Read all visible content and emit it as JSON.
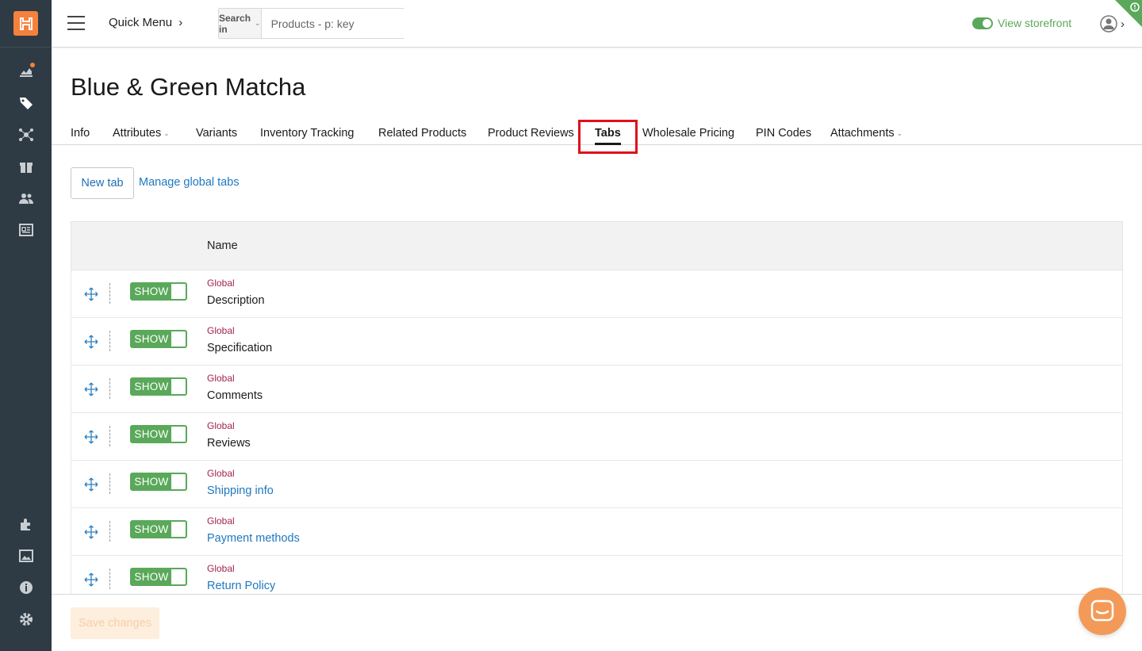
{
  "header": {
    "quick_menu": "Quick Menu",
    "search_in": "Search in",
    "search_placeholder": "Products - p: key",
    "view_storefront": "View storefront"
  },
  "product": {
    "title": "Blue & Green Matcha"
  },
  "tabs": [
    {
      "label": "Info"
    },
    {
      "label": "Attributes",
      "dropdown": true
    },
    {
      "label": "Variants"
    },
    {
      "label": "Inventory Tracking"
    },
    {
      "label": "Related Products"
    },
    {
      "label": "Product Reviews"
    },
    {
      "label": "Tabs",
      "active": true
    },
    {
      "label": "Wholesale Pricing"
    },
    {
      "label": "PIN Codes"
    },
    {
      "label": "Attachments",
      "dropdown": true
    }
  ],
  "actions": {
    "new_tab": "New tab",
    "manage_global_tabs": "Manage global tabs"
  },
  "table": {
    "name_header": "Name",
    "rows": [
      {
        "scope": "Global",
        "name": "Description",
        "toggle": "SHOW",
        "link": false
      },
      {
        "scope": "Global",
        "name": "Specification",
        "toggle": "SHOW",
        "link": false
      },
      {
        "scope": "Global",
        "name": "Comments",
        "toggle": "SHOW",
        "link": false
      },
      {
        "scope": "Global",
        "name": "Reviews",
        "toggle": "SHOW",
        "link": false
      },
      {
        "scope": "Global",
        "name": "Shipping info",
        "toggle": "SHOW",
        "link": true
      },
      {
        "scope": "Global",
        "name": "Payment methods",
        "toggle": "SHOW",
        "link": true
      },
      {
        "scope": "Global",
        "name": "Return Policy",
        "toggle": "SHOW",
        "link": true
      }
    ]
  },
  "footer": {
    "save_changes": "Save changes"
  },
  "colors": {
    "sidebar": "#2e3b44",
    "accent_orange": "#f5813c",
    "green": "#5aa85a",
    "link_blue": "#1f78c1",
    "global_label": "#a2264b",
    "highlight_red": "#e0101a"
  }
}
